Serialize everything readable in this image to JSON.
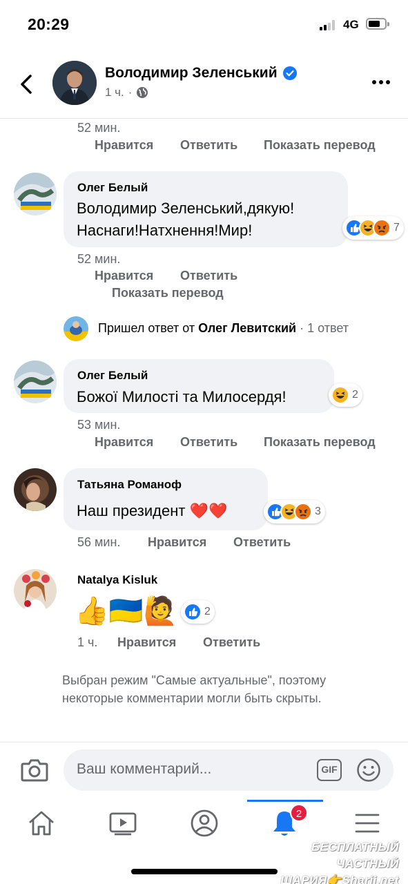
{
  "status_bar": {
    "time": "20:29",
    "network": "4G"
  },
  "header": {
    "title": "Володимир Зеленський",
    "time": "1 ч.",
    "separator": "·"
  },
  "top_partial": {
    "time": "52 мин.",
    "like": "Нравится",
    "reply": "Ответить",
    "translate": "Показать перевод"
  },
  "comments": [
    {
      "author": "Олег Белый",
      "text_lines": [
        "Володимир Зеленський,дякую!",
        "Наснаги!Натхнення!Мир!"
      ],
      "reaction_count": "7",
      "time": "52 мин.",
      "like": "Нравится",
      "reply": "Ответить",
      "translate": "Показать перевод"
    },
    {
      "author": "Олег Белый",
      "text": "Божої Милості та Милосердя!",
      "reaction_count": "2",
      "time": "53 мин.",
      "like": "Нравится",
      "reply": "Ответить",
      "translate": "Показать перевод"
    },
    {
      "author": "Татьяна Романоф",
      "text": "Наш президент ❤️❤️",
      "reaction_count": "3",
      "time": "56 мин.",
      "like": "Нравится",
      "reply": "Ответить"
    },
    {
      "author": "Natalya Kisluk",
      "text": "👍🇺🇦🙋",
      "reaction_count": "2",
      "time": "1 ч.",
      "like": "Нравится",
      "reply": "Ответить"
    }
  ],
  "reply_thread": {
    "prefix": "Пришел ответ от",
    "name": "Олег Левитский",
    "suffix": "· 1 ответ"
  },
  "note": "Выбран режим \"Самые актуальные\", поэтому некоторые комментарии могли быть скрыты.",
  "composer": {
    "placeholder": "Ваш комментарий...",
    "gif_label": "GIF"
  },
  "tabbar": {
    "notification_count": "2"
  },
  "watermark": {
    "line1": "БЕСПЛАТНЫЙ ЧАСТНЫЙ",
    "line2": "ШАРИЯ👉Sharij.net"
  },
  "colors": {
    "accent": "#1877f2",
    "badge": "#e41e3f",
    "bubble": "#f0f2f5",
    "secondary_text": "#65676b"
  }
}
